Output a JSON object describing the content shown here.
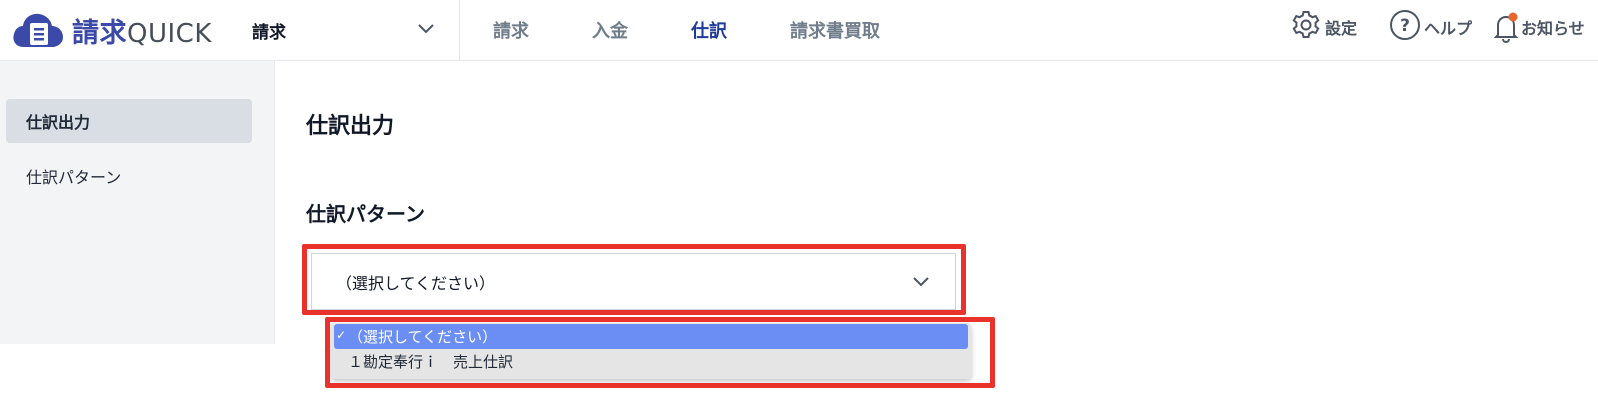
{
  "header": {
    "logo": {
      "kanji": "請求",
      "latin": "QUICK",
      "icon": "cloud-document-icon",
      "brand_color": "#3b4aa8"
    },
    "app_selector": {
      "label": "請求",
      "icon": "chevron-down-icon"
    },
    "nav": [
      {
        "label": "請求",
        "active": false
      },
      {
        "label": "入金",
        "active": false
      },
      {
        "label": "仕訳",
        "active": true
      },
      {
        "label": "請求書買取",
        "active": false
      }
    ],
    "actions": {
      "settings": {
        "label": "設定",
        "icon": "gear-icon"
      },
      "help": {
        "label": "ヘルプ",
        "icon": "question-circle-icon"
      },
      "notifications": {
        "label": "お知らせ",
        "icon": "bell-icon",
        "badge_color": "#e8652b"
      }
    }
  },
  "sidebar": {
    "items": [
      {
        "label": "仕訳出力",
        "active": true
      },
      {
        "label": "仕訳パターン",
        "active": false
      }
    ]
  },
  "main": {
    "page_title": "仕訳出力",
    "section_title": "仕訳パターン",
    "select": {
      "value": "（選択してください）",
      "icon": "chevron-down-icon",
      "options": [
        {
          "label": "（選択してください）",
          "selected": true,
          "check": "✓"
        },
        {
          "label": "１勘定奉行ｉ　売上仕訳",
          "selected": false
        }
      ]
    }
  },
  "colors": {
    "highlight": "#e8322b",
    "nav_active": "#1e3a9a",
    "option_selected": "#6b8ef5"
  }
}
